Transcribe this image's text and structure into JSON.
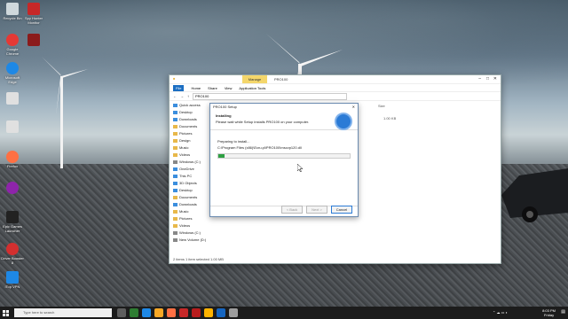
{
  "desktop": {
    "watermark": "",
    "icons": [
      {
        "label": "Recycle Bin",
        "color": "#cfd8dc"
      },
      {
        "label": "Google Chrome",
        "color": "#e53935"
      },
      {
        "label": "Microsoft Edge",
        "color": "#1e88e5"
      },
      {
        "label": "",
        "color": "#e0e0e0"
      },
      {
        "label": "",
        "color": "#e0e0e0"
      },
      {
        "label": "Firefox",
        "color": "#ff7043"
      },
      {
        "label": "",
        "color": "#8e24aa"
      },
      {
        "label": "Epic Games Launcher",
        "color": "#222222"
      },
      {
        "label": "Driver Booster 8",
        "color": "#d32f2f"
      },
      {
        "label": "iTop VPN",
        "color": "#1e88e5"
      },
      {
        "label": "Spy Hunter Monitor",
        "color": "#c62828"
      },
      {
        "label": "",
        "color": "#8b1b1b"
      }
    ]
  },
  "explorer": {
    "manage_label": "Manage",
    "title": "PRO100",
    "ribbon": [
      "File",
      "Home",
      "Share",
      "View",
      "Application Tools"
    ],
    "address": "PRO100",
    "size_header": "Size",
    "size_value": "1.00 KB",
    "nav": [
      "Quick access",
      "Desktop",
      "Downloads",
      "Documents",
      "Pictures",
      "Design",
      "Music",
      "Videos",
      "Windows (C:)",
      "OneDrive",
      "This PC",
      "3D Objects",
      "Desktop",
      "Documents",
      "Downloads",
      "Music",
      "Pictures",
      "Videos",
      "Windows (C:)",
      "New Volume (D:)"
    ],
    "status": "2 items    1 item selected  1.00 MB"
  },
  "setup": {
    "window_title": "PRO100 Setup",
    "heading": "Installing",
    "subheading": "Please wait while Setup installs PRO100 on your computer.",
    "status": "Preparing to install...",
    "path": "C:\\Program Files (x86)\\Ecru.pl\\PRO100\\mscvp120.dll",
    "progress": 0.05,
    "back_label": "< Back",
    "next_label": "Next >",
    "cancel_label": "Cancel"
  },
  "taskbar": {
    "search_placeholder": "Type here to search",
    "time": "8:03 PM",
    "day": "Friday",
    "date": "",
    "icons": [
      "#5e5e5e",
      "#2e7d32",
      "#1e88e5",
      "#f9a825",
      "#ff7043",
      "#c62828",
      "#b71c1c",
      "#ffb300",
      "#1565c0",
      "#9e9e9e"
    ]
  }
}
